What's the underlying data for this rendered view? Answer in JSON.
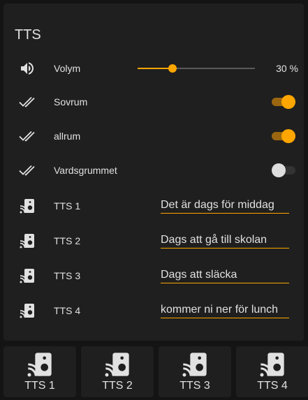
{
  "card": {
    "title": "TTS",
    "volume": {
      "label": "Volym",
      "value": 30,
      "value_text": "30 %"
    },
    "switches": [
      {
        "label": "Sovrum",
        "state": "on"
      },
      {
        "label": "allrum",
        "state": "on"
      },
      {
        "label": "Vardsgrummet",
        "state": "off"
      }
    ],
    "tts": [
      {
        "label": "TTS 1",
        "value": "Det är dags för middag"
      },
      {
        "label": "TTS 2",
        "value": "Dags att gå till skolan"
      },
      {
        "label": "TTS 3",
        "value": "Dags att släcka"
      },
      {
        "label": "TTS 4",
        "value": "kommer ni ner för lunch"
      }
    ]
  },
  "buttons": [
    {
      "label": "TTS 1"
    },
    {
      "label": "TTS 2"
    },
    {
      "label": "TTS 3"
    },
    {
      "label": "TTS 4"
    }
  ],
  "colors": {
    "accent": "#ffa600",
    "card": "#1f1f1f",
    "background": "#141414",
    "text": "#e1e1e1"
  },
  "icons": {
    "volume": "volume-high-icon",
    "switch": "check-all-icon",
    "tts": "speaker-wireless-icon"
  }
}
